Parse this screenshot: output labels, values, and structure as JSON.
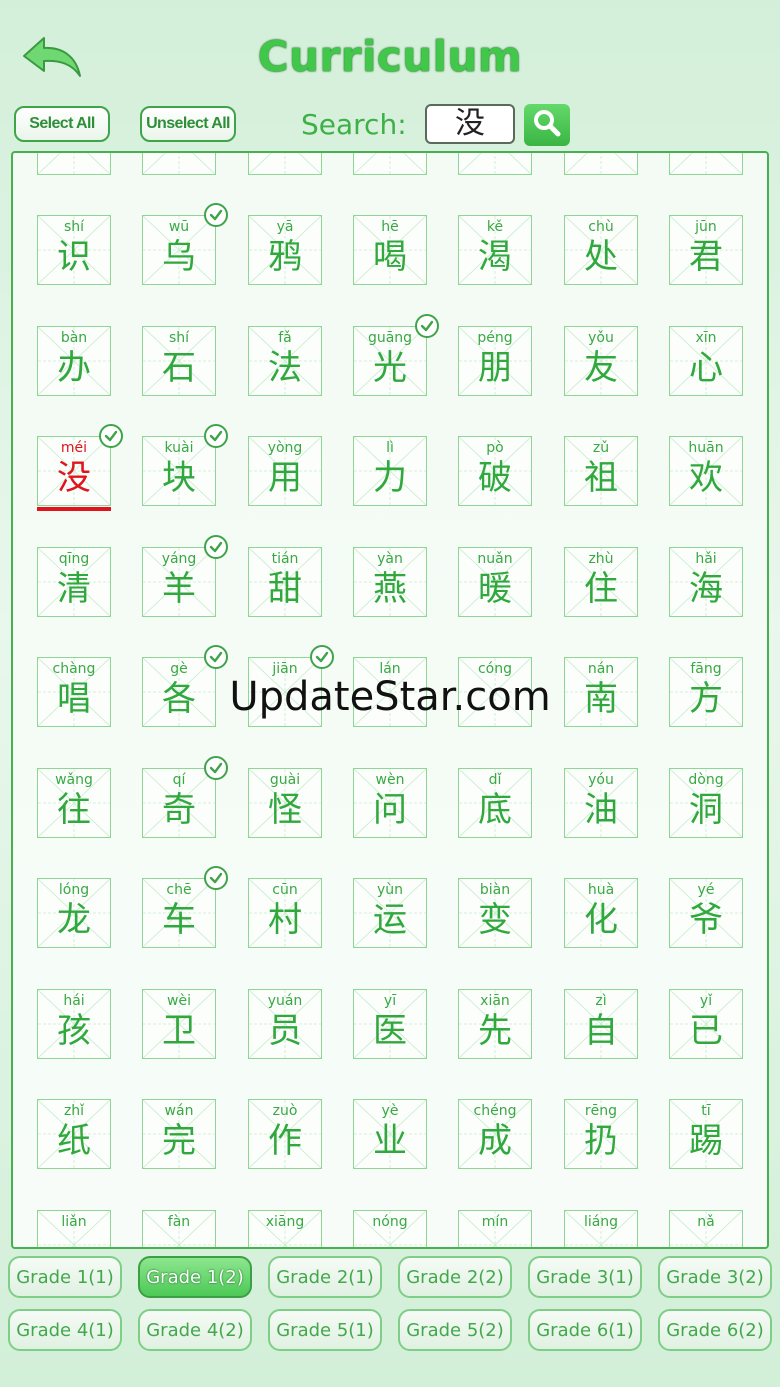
{
  "header": {
    "title": "Curriculum",
    "select_all_label": "Select All",
    "unselect_all_label": "Unselect All",
    "search_label": "Search:",
    "search_value": "没"
  },
  "characters": [
    {
      "pinyin": "shí",
      "hanzi": "识",
      "checked": false,
      "selected": false
    },
    {
      "pinyin": "wū",
      "hanzi": "乌",
      "checked": true,
      "selected": false
    },
    {
      "pinyin": "yā",
      "hanzi": "鸦",
      "checked": false,
      "selected": false
    },
    {
      "pinyin": "hē",
      "hanzi": "喝",
      "checked": false,
      "selected": false
    },
    {
      "pinyin": "kě",
      "hanzi": "渴",
      "checked": false,
      "selected": false
    },
    {
      "pinyin": "chù",
      "hanzi": "处",
      "checked": false,
      "selected": false
    },
    {
      "pinyin": "jūn",
      "hanzi": "君",
      "checked": false,
      "selected": false
    },
    {
      "pinyin": "bàn",
      "hanzi": "办",
      "checked": false,
      "selected": false
    },
    {
      "pinyin": "shí",
      "hanzi": "石",
      "checked": false,
      "selected": false
    },
    {
      "pinyin": "fǎ",
      "hanzi": "法",
      "checked": false,
      "selected": false
    },
    {
      "pinyin": "guāng",
      "hanzi": "光",
      "checked": true,
      "selected": false
    },
    {
      "pinyin": "péng",
      "hanzi": "朋",
      "checked": false,
      "selected": false
    },
    {
      "pinyin": "yǒu",
      "hanzi": "友",
      "checked": false,
      "selected": false
    },
    {
      "pinyin": "xīn",
      "hanzi": "心",
      "checked": false,
      "selected": false
    },
    {
      "pinyin": "méi",
      "hanzi": "没",
      "checked": true,
      "selected": true
    },
    {
      "pinyin": "kuài",
      "hanzi": "块",
      "checked": true,
      "selected": false
    },
    {
      "pinyin": "yòng",
      "hanzi": "用",
      "checked": false,
      "selected": false
    },
    {
      "pinyin": "lì",
      "hanzi": "力",
      "checked": false,
      "selected": false
    },
    {
      "pinyin": "pò",
      "hanzi": "破",
      "checked": false,
      "selected": false
    },
    {
      "pinyin": "zǔ",
      "hanzi": "祖",
      "checked": false,
      "selected": false
    },
    {
      "pinyin": "huān",
      "hanzi": "欢",
      "checked": false,
      "selected": false
    },
    {
      "pinyin": "qīng",
      "hanzi": "清",
      "checked": false,
      "selected": false
    },
    {
      "pinyin": "yáng",
      "hanzi": "羊",
      "checked": true,
      "selected": false
    },
    {
      "pinyin": "tián",
      "hanzi": "甜",
      "checked": false,
      "selected": false
    },
    {
      "pinyin": "yàn",
      "hanzi": "燕",
      "checked": false,
      "selected": false
    },
    {
      "pinyin": "nuǎn",
      "hanzi": "暖",
      "checked": false,
      "selected": false
    },
    {
      "pinyin": "zhù",
      "hanzi": "住",
      "checked": false,
      "selected": false
    },
    {
      "pinyin": "hǎi",
      "hanzi": "海",
      "checked": false,
      "selected": false
    },
    {
      "pinyin": "chàng",
      "hanzi": "唱",
      "checked": false,
      "selected": false
    },
    {
      "pinyin": "gè",
      "hanzi": "各",
      "checked": true,
      "selected": false
    },
    {
      "pinyin": "jiān",
      "hanzi": "",
      "checked": true,
      "selected": false
    },
    {
      "pinyin": "lán",
      "hanzi": "",
      "checked": false,
      "selected": false
    },
    {
      "pinyin": "cóng",
      "hanzi": "",
      "checked": false,
      "selected": false
    },
    {
      "pinyin": "nán",
      "hanzi": "南",
      "checked": false,
      "selected": false
    },
    {
      "pinyin": "fāng",
      "hanzi": "方",
      "checked": false,
      "selected": false
    },
    {
      "pinyin": "wǎng",
      "hanzi": "往",
      "checked": false,
      "selected": false
    },
    {
      "pinyin": "qí",
      "hanzi": "奇",
      "checked": true,
      "selected": false
    },
    {
      "pinyin": "guài",
      "hanzi": "怪",
      "checked": false,
      "selected": false
    },
    {
      "pinyin": "wèn",
      "hanzi": "问",
      "checked": false,
      "selected": false
    },
    {
      "pinyin": "dǐ",
      "hanzi": "底",
      "checked": false,
      "selected": false
    },
    {
      "pinyin": "yóu",
      "hanzi": "油",
      "checked": false,
      "selected": false
    },
    {
      "pinyin": "dòng",
      "hanzi": "洞",
      "checked": false,
      "selected": false
    },
    {
      "pinyin": "lóng",
      "hanzi": "龙",
      "checked": false,
      "selected": false
    },
    {
      "pinyin": "chē",
      "hanzi": "车",
      "checked": true,
      "selected": false
    },
    {
      "pinyin": "cūn",
      "hanzi": "村",
      "checked": false,
      "selected": false
    },
    {
      "pinyin": "yùn",
      "hanzi": "运",
      "checked": false,
      "selected": false
    },
    {
      "pinyin": "biàn",
      "hanzi": "变",
      "checked": false,
      "selected": false
    },
    {
      "pinyin": "huà",
      "hanzi": "化",
      "checked": false,
      "selected": false
    },
    {
      "pinyin": "yé",
      "hanzi": "爷",
      "checked": false,
      "selected": false
    },
    {
      "pinyin": "hái",
      "hanzi": "孩",
      "checked": false,
      "selected": false
    },
    {
      "pinyin": "wèi",
      "hanzi": "卫",
      "checked": false,
      "selected": false
    },
    {
      "pinyin": "yuán",
      "hanzi": "员",
      "checked": false,
      "selected": false
    },
    {
      "pinyin": "yī",
      "hanzi": "医",
      "checked": false,
      "selected": false
    },
    {
      "pinyin": "xiān",
      "hanzi": "先",
      "checked": false,
      "selected": false
    },
    {
      "pinyin": "zì",
      "hanzi": "自",
      "checked": false,
      "selected": false
    },
    {
      "pinyin": "yǐ",
      "hanzi": "已",
      "checked": false,
      "selected": false
    },
    {
      "pinyin": "zhǐ",
      "hanzi": "纸",
      "checked": false,
      "selected": false
    },
    {
      "pinyin": "wán",
      "hanzi": "完",
      "checked": false,
      "selected": false
    },
    {
      "pinyin": "zuò",
      "hanzi": "作",
      "checked": false,
      "selected": false
    },
    {
      "pinyin": "yè",
      "hanzi": "业",
      "checked": false,
      "selected": false
    },
    {
      "pinyin": "chéng",
      "hanzi": "成",
      "checked": false,
      "selected": false
    },
    {
      "pinyin": "rēng",
      "hanzi": "扔",
      "checked": false,
      "selected": false
    },
    {
      "pinyin": "tī",
      "hanzi": "踢",
      "checked": false,
      "selected": false
    },
    {
      "pinyin": "liǎn",
      "hanzi": "",
      "checked": false,
      "selected": false
    },
    {
      "pinyin": "fàn",
      "hanzi": "",
      "checked": false,
      "selected": false
    },
    {
      "pinyin": "xiāng",
      "hanzi": "",
      "checked": false,
      "selected": false
    },
    {
      "pinyin": "nóng",
      "hanzi": "",
      "checked": false,
      "selected": false
    },
    {
      "pinyin": "mín",
      "hanzi": "",
      "checked": false,
      "selected": false
    },
    {
      "pinyin": "liáng",
      "hanzi": "",
      "checked": false,
      "selected": false
    },
    {
      "pinyin": "nǎ",
      "hanzi": "",
      "checked": false,
      "selected": false
    }
  ],
  "grades": [
    {
      "label": "Grade 1(1)",
      "active": false
    },
    {
      "label": "Grade 1(2)",
      "active": true
    },
    {
      "label": "Grade 2(1)",
      "active": false
    },
    {
      "label": "Grade 2(2)",
      "active": false
    },
    {
      "label": "Grade 3(1)",
      "active": false
    },
    {
      "label": "Grade 3(2)",
      "active": false
    },
    {
      "label": "Grade 4(1)",
      "active": false
    },
    {
      "label": "Grade 4(2)",
      "active": false
    },
    {
      "label": "Grade 5(1)",
      "active": false
    },
    {
      "label": "Grade 5(2)",
      "active": false
    },
    {
      "label": "Grade 6(1)",
      "active": false
    },
    {
      "label": "Grade 6(2)",
      "active": false
    }
  ],
  "watermark": "UpdateStar.com",
  "colors": {
    "accent": "#41c84a",
    "selected": "#e0141c",
    "grid_line": "#8fd596"
  }
}
